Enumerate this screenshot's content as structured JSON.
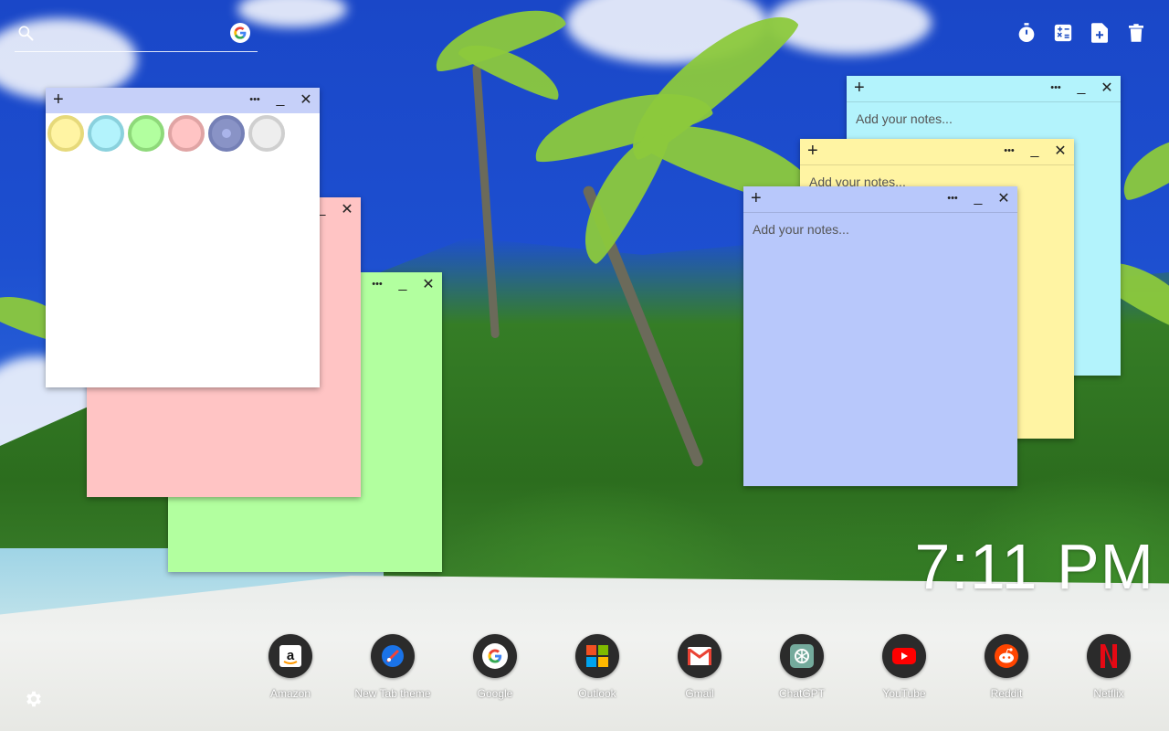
{
  "search": {
    "placeholder": ""
  },
  "toolbar": [
    {
      "name": "timer-icon"
    },
    {
      "name": "calculator-icon"
    },
    {
      "name": "new-note-icon"
    },
    {
      "name": "trash-icon"
    }
  ],
  "notes": {
    "add_label": "+",
    "more_label": "•••",
    "minimize_label": "_",
    "close_label": "✕",
    "placeholder": "Add your notes...",
    "colors": {
      "white": "#ffffff",
      "pink": "#ffc4c4",
      "green": "#b2ff9f",
      "cyan": "#b3f3fc",
      "yellow": "#fff4a3",
      "blue": "#b8c8fb",
      "bar_blue": "#c6d0f9"
    }
  },
  "swatches": [
    {
      "name": "yellow",
      "fill": "#fff4a3",
      "ring": "#e6d97a"
    },
    {
      "name": "cyan",
      "fill": "#b3f3fc",
      "ring": "#8ad1dd"
    },
    {
      "name": "green",
      "fill": "#b2ff9f",
      "ring": "#8ed97a"
    },
    {
      "name": "pink",
      "fill": "#ffc4c4",
      "ring": "#e0a4a4"
    },
    {
      "name": "blue",
      "fill": "#8993c6",
      "ring": "#7580b6"
    },
    {
      "name": "gray",
      "fill": "#eeeeee",
      "ring": "#cfcfcf"
    }
  ],
  "clock": {
    "time": "7:11 PM"
  },
  "dock": [
    {
      "label": "Amazon",
      "icon": "amazon-icon"
    },
    {
      "label": "New Tab theme",
      "icon": "new-tab-theme-icon"
    },
    {
      "label": "Google",
      "icon": "google-icon"
    },
    {
      "label": "Outlook",
      "icon": "outlook-icon"
    },
    {
      "label": "Gmail",
      "icon": "gmail-icon"
    },
    {
      "label": "ChatGPT",
      "icon": "chatgpt-icon"
    },
    {
      "label": "YouTube",
      "icon": "youtube-icon"
    },
    {
      "label": "Reddit",
      "icon": "reddit-icon"
    },
    {
      "label": "Netflix",
      "icon": "netflix-icon"
    }
  ]
}
